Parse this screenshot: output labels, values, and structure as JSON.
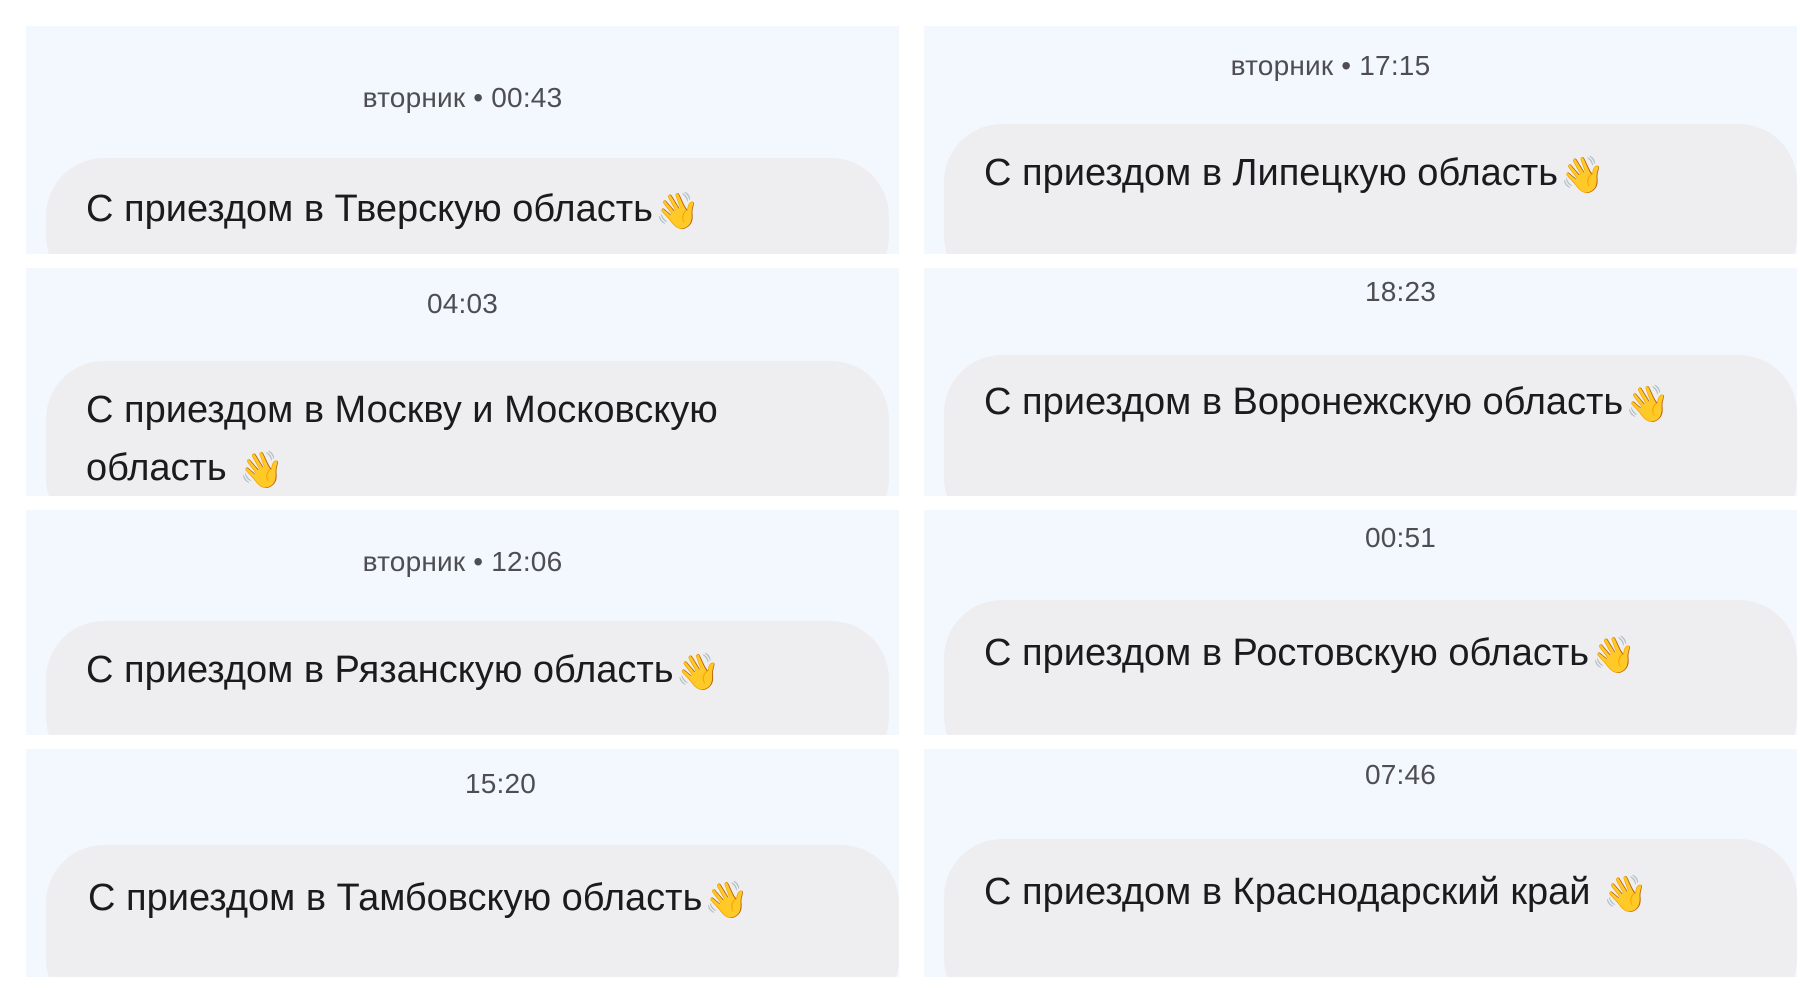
{
  "chat_cards": [
    {
      "timestamp": "вторник • 00:43",
      "message": "С приездом в Тверскую область",
      "emoji": "👋"
    },
    {
      "timestamp": "04:03",
      "message": "С приездом в Москву и Московскую область",
      "emoji": "👋"
    },
    {
      "timestamp": "вторник • 12:06",
      "message": "С приездом в Рязанскую область",
      "emoji": "👋"
    },
    {
      "timestamp": "15:20",
      "message": "С приездом в Тамбовскую область",
      "emoji": "👋"
    },
    {
      "timestamp": "вторник • 17:15",
      "message": "С приездом в Липецкую область",
      "emoji": "👋"
    },
    {
      "timestamp": "18:23",
      "message": "С приездом в Воронежскую область",
      "emoji": "👋"
    },
    {
      "timestamp": "00:51",
      "message": "С приездом в Ростовскую область",
      "emoji": "👋"
    },
    {
      "timestamp": "07:46",
      "message": "С приездом в Краснодарский край",
      "emoji": "👋"
    }
  ],
  "colors": {
    "panel_background": "#f3f8fe",
    "bubble_background": "#eeeef1",
    "timestamp_text": "#4e4e52",
    "message_text": "#1b1b1d",
    "emoji_color": "#f2b51c"
  },
  "icons": {
    "message_emoji": "waving-hand-icon"
  }
}
